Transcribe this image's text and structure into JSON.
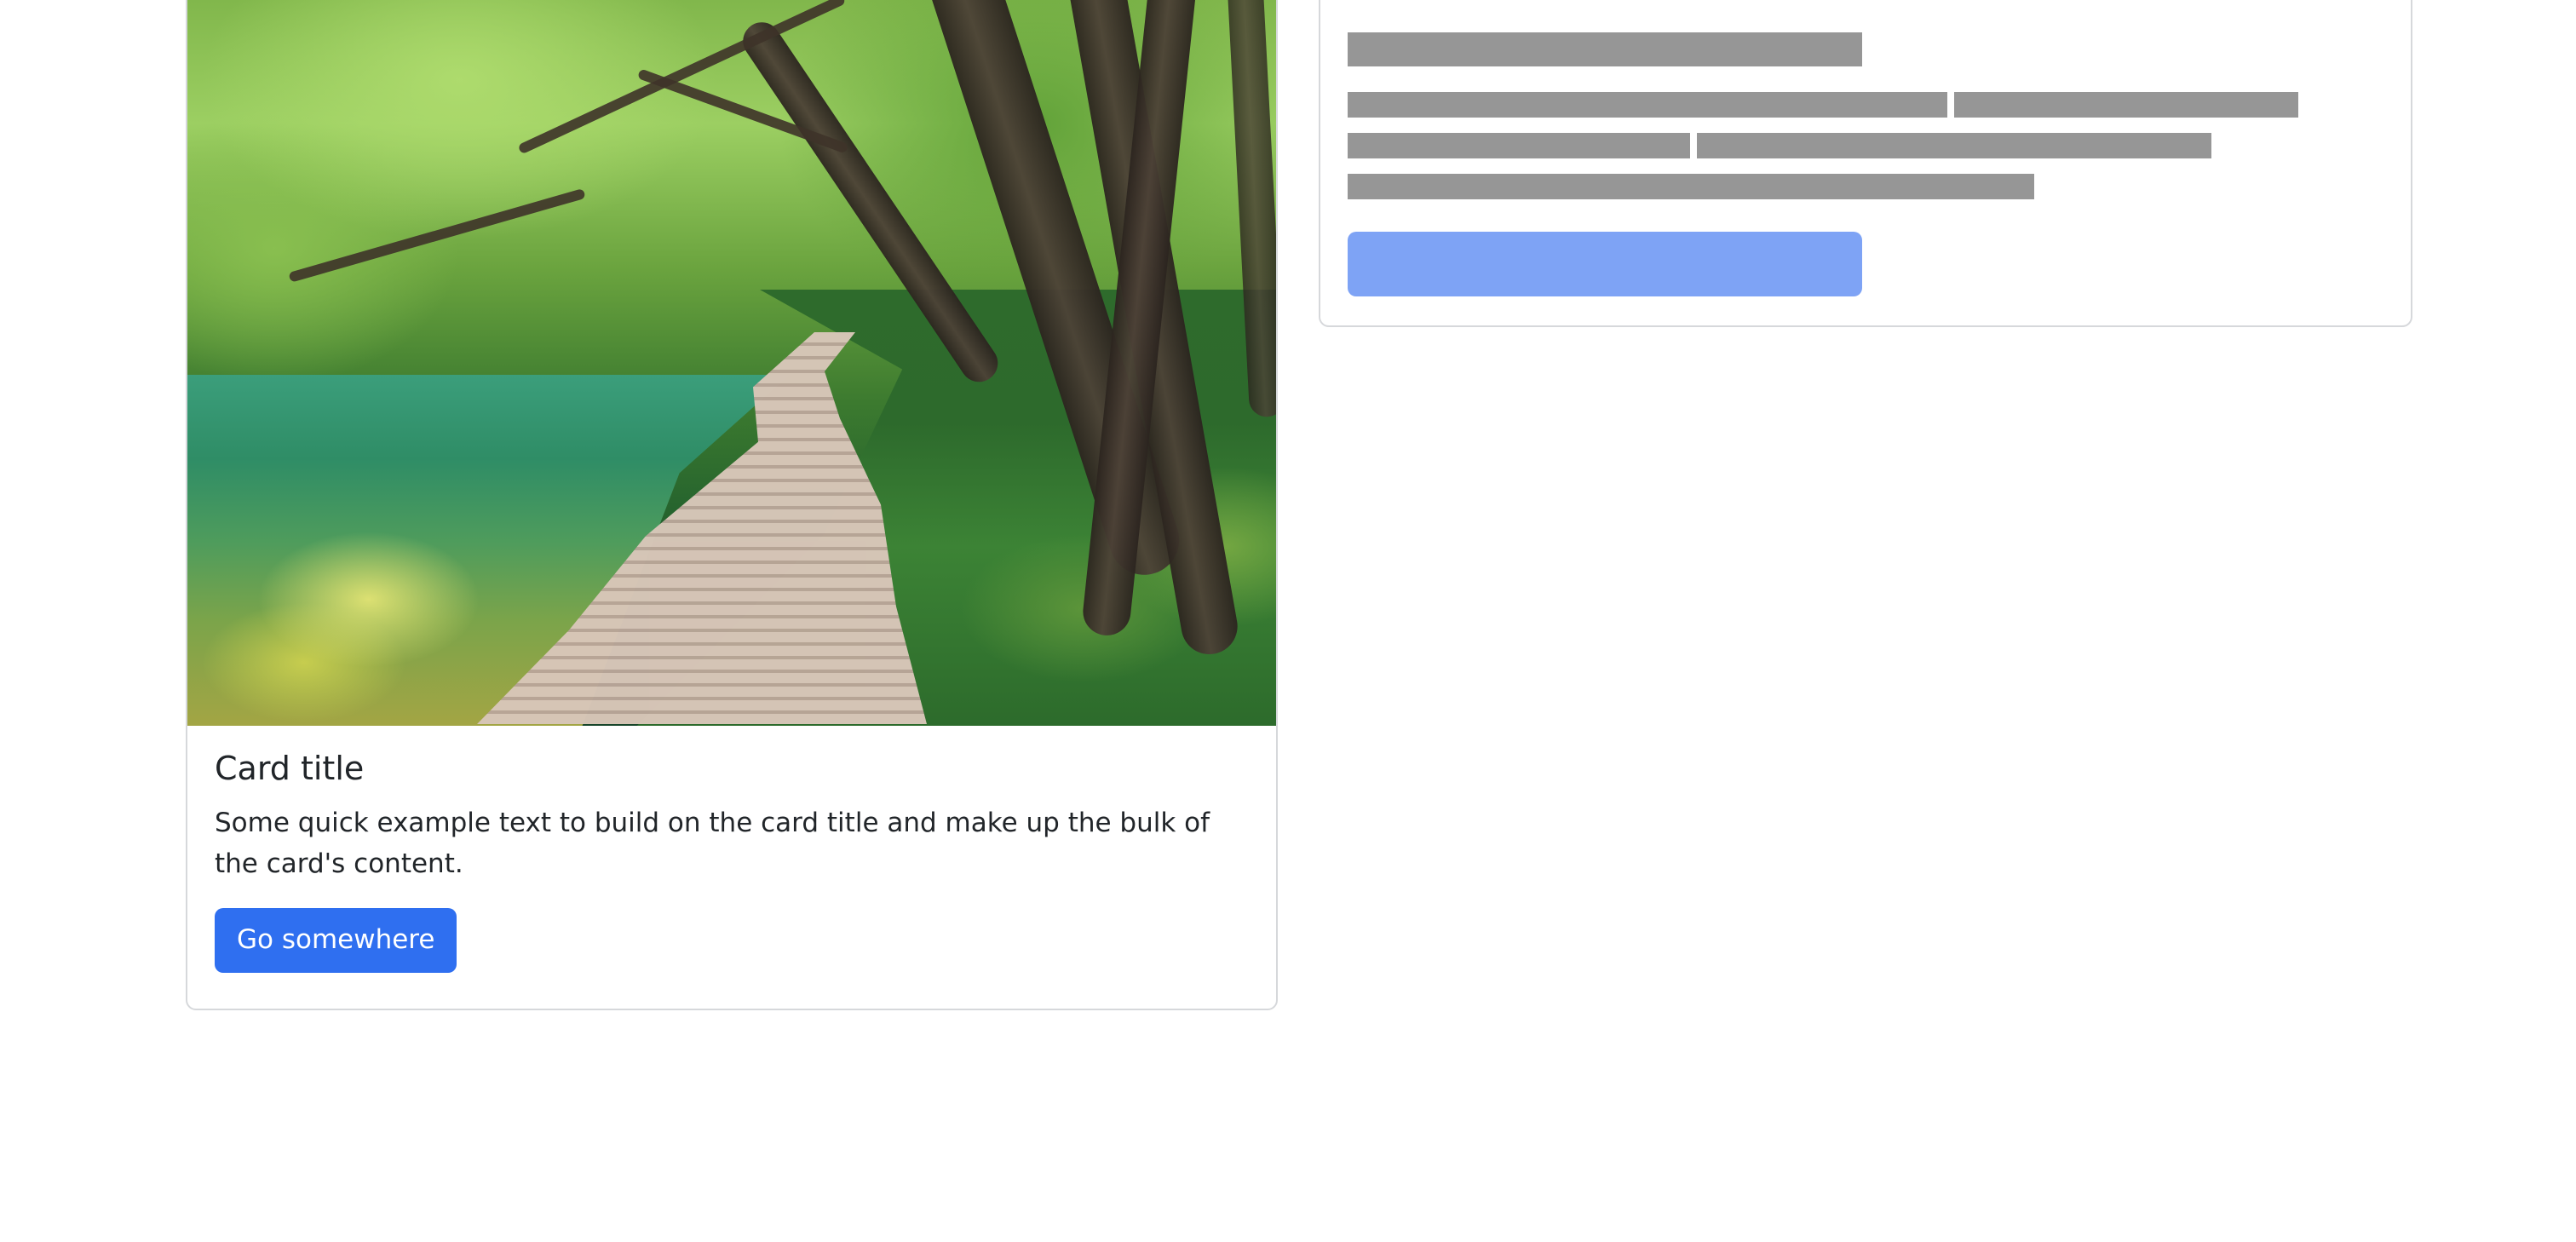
{
  "card": {
    "title": "Card title",
    "text": "Some quick example text to build on the card title and make up the bulk of the card's content.",
    "button_label": "Go somewhere",
    "image_name": "forest-boardwalk-image"
  },
  "placeholder_card": {
    "state": "loading"
  },
  "colors": {
    "button": "#2f6ff0",
    "placeholder": "#969696",
    "placeholder_button": "#7ea3f5",
    "border": "#d6d8db"
  }
}
